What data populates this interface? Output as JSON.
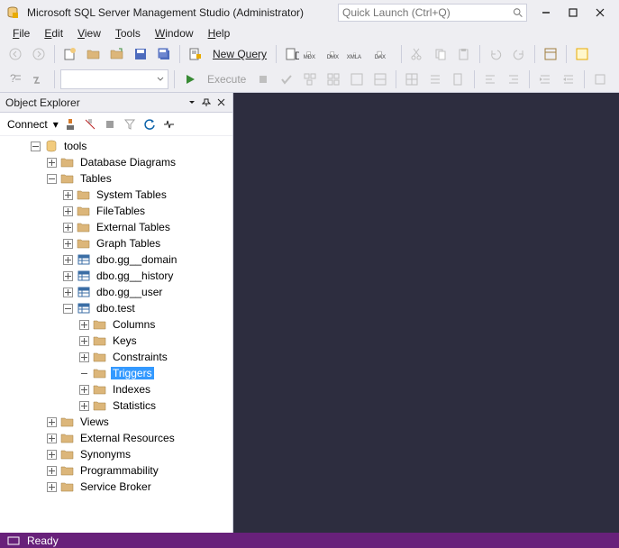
{
  "title": "Microsoft SQL Server Management Studio (Administrator)",
  "quick_launch_placeholder": "Quick Launch (Ctrl+Q)",
  "menus": {
    "file": "File",
    "edit": "Edit",
    "view": "View",
    "tools": "Tools",
    "window": "Window",
    "help": "Help"
  },
  "toolbar": {
    "new_query": "New Query",
    "execute": "Execute"
  },
  "panel": {
    "title": "Object Explorer",
    "connect": "Connect"
  },
  "tree": {
    "root": "tools",
    "dbdiagrams": "Database Diagrams",
    "tables": "Tables",
    "systables": "System Tables",
    "filetables": "FileTables",
    "exttables": "External Tables",
    "graphtables": "Graph Tables",
    "t1": "dbo.gg__domain",
    "t2": "dbo.gg__history",
    "t3": "dbo.gg__user",
    "t4": "dbo.test",
    "columns": "Columns",
    "keys": "Keys",
    "constraints": "Constraints",
    "triggers": "Triggers",
    "indexes": "Indexes",
    "statistics": "Statistics",
    "views": "Views",
    "extres": "External Resources",
    "synonyms": "Synonyms",
    "prog": "Programmability",
    "sb": "Service Broker"
  },
  "status": "Ready"
}
